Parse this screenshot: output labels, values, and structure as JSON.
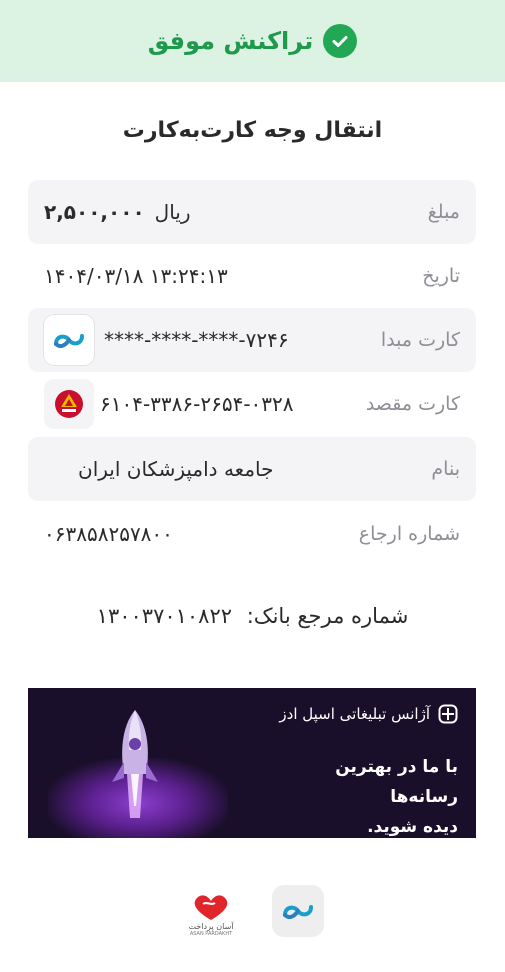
{
  "header": {
    "status": "تراکنش موفق",
    "icon": "check-circle-icon",
    "color": "#22a855",
    "bg": "#dcf3e4"
  },
  "title": "انتقال وجه کارت‌به‌کارت",
  "details": {
    "amount": {
      "label": "مبلغ",
      "value": "۲,۵۰۰,۰۰۰",
      "unit": "ریال"
    },
    "date": {
      "label": "تاریخ",
      "value": "۱۴۰۴/۰۳/۱۸  ۱۳:۲۴:۱۳"
    },
    "source_card": {
      "label": "کارت مبدا",
      "value": "****-****-****-۷۲۴۶",
      "logo": "asan-pardakht-logo"
    },
    "dest_card": {
      "label": "کارت مقصد",
      "value": "۶۱۰۴-۳۳۸۶-۲۶۵۴-۰۳۲۸",
      "logo": "bank-mellat-logo"
    },
    "name": {
      "label": "بنام",
      "value": "جامعه دامپزشکان ایران"
    },
    "ref": {
      "label": "شماره ارجاع",
      "value": "۰۶۳۸۵۸۲۵۷۸۰۰"
    }
  },
  "bank_ref": {
    "label": "شماره مرجع بانک:",
    "value": "۱۳۰۰۳۷۰۱۰۸۲۲"
  },
  "ad": {
    "agency": "آژانس تبلیغاتی اسپل ادز",
    "tagline_line1": "با ما در بهترین رسانه‌ها",
    "tagline_line2": "دیده شوید."
  },
  "footer": {
    "logo_left_text": "آسان پرداخت",
    "logo_left_subtext": "ASAN PARDAKHT"
  }
}
